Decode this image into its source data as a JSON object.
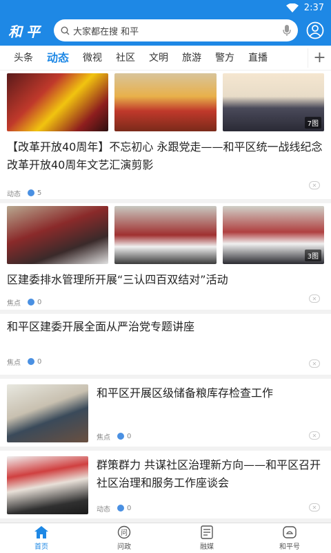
{
  "status_bar": {
    "time": "2:37"
  },
  "header": {
    "logo_text": "和平",
    "search_placeholder": "大家都在搜 和平"
  },
  "tabs": [
    {
      "label": "头条",
      "active": false
    },
    {
      "label": "动态",
      "active": true
    },
    {
      "label": "微视",
      "active": false
    },
    {
      "label": "社区",
      "active": false
    },
    {
      "label": "文明",
      "active": false
    },
    {
      "label": "旅游",
      "active": false
    },
    {
      "label": "警方",
      "active": false
    },
    {
      "label": "直播",
      "active": false
    }
  ],
  "tab_add_label": "+",
  "feed": [
    {
      "type": "three-image",
      "title": "【改革开放40周年】不忘初心 永跟党走——和平区统一战线纪念改革开放40周年文艺汇演剪影",
      "source": "动态",
      "count": "5",
      "image_count": "7图"
    },
    {
      "type": "three-image",
      "title": "区建委排水管理所开展“三认四百双结对”活动",
      "source": "焦点",
      "count": "0",
      "image_count": "3图"
    },
    {
      "type": "text",
      "title": "和平区建委开展全面从严治党专题讲座",
      "source": "焦点",
      "count": "0"
    },
    {
      "type": "side-image",
      "title": "和平区开展区级储备粮库存检查工作",
      "source": "焦点",
      "count": "0"
    },
    {
      "type": "side-image",
      "title": "群策群力 共谋社区治理新方向——和平区召开社区治理和服务工作座谈会",
      "source": "动态",
      "count": "0"
    }
  ],
  "bottom_nav": [
    {
      "label": "首页",
      "icon": "home-icon",
      "active": true
    },
    {
      "label": "问政",
      "icon": "ask-icon",
      "active": false
    },
    {
      "label": "融媒",
      "icon": "media-icon",
      "active": false
    },
    {
      "label": "和平号",
      "icon": "account-icon",
      "active": false
    }
  ],
  "colors": {
    "brand": "#1e88e5",
    "divider": "#f2f2f2"
  }
}
